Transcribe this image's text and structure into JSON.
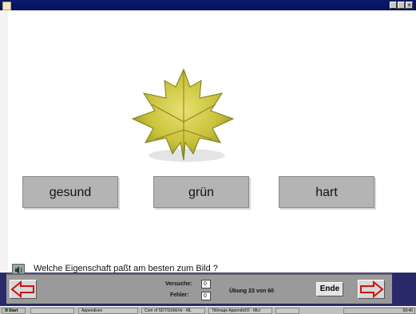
{
  "window": {
    "minimize_glyph": "_",
    "close_glyph": "×"
  },
  "answers": [
    "gesund",
    "grün",
    "hart"
  ],
  "question": "Welche Eigenschaft paßt am besten zum Bild ?",
  "toolbar": {
    "versuche_label": "Versuche:",
    "versuche_value": "0",
    "fehler_label": "Fehler:",
    "fehler_value": "0",
    "exercise_status": "Übung 23 von 60",
    "end_label": "Ende"
  },
  "taskbar": {
    "start_label": "Start",
    "items": [
      "Appendixes",
      "Com of SDT/SShEVe - ML",
      "Titlimage Appendix02 - Micr",
      ""
    ],
    "clock": "09:40"
  },
  "colors": {
    "accent_arrow": "#cc1010",
    "answer_bg": "#b4b4b4",
    "leaf": "#c8c23a"
  },
  "icons": [
    "app-icon",
    "speaker-icon",
    "arrow-left-icon",
    "arrow-right-icon",
    "windows-logo-icon"
  ]
}
